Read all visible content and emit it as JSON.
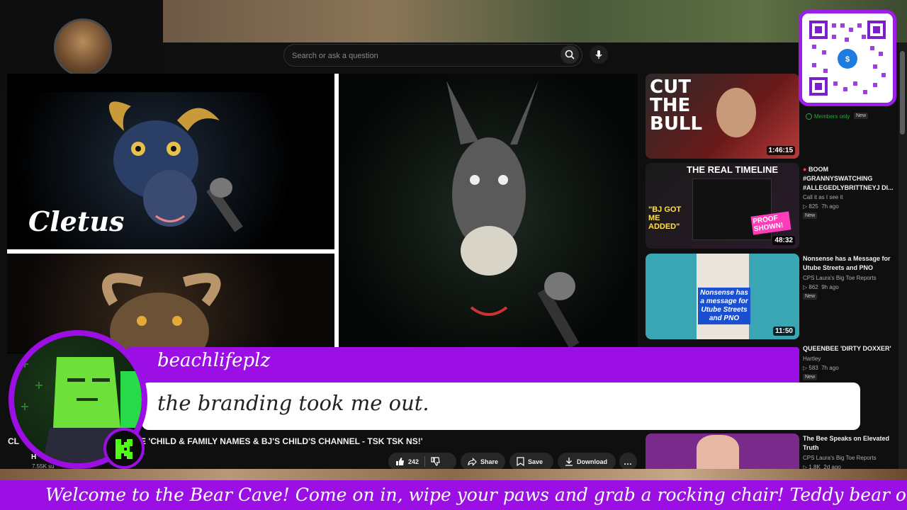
{
  "search": {
    "placeholder": "Search or ask a question"
  },
  "video": {
    "tile_label": "Cletus",
    "title_start": "CL",
    "title_rest": "E 'CHILD & FAMILY NAMES & BJ'S CHILD'S CHANNEL - TSK TSK NS!'",
    "channel_initial": "H",
    "subscriber_count": "7.55K su",
    "likes": "242",
    "share_label": "Share",
    "save_label": "Save",
    "download_label": "Download"
  },
  "chat": {
    "username": "beachlifeplz",
    "message": "the branding took me out."
  },
  "sidebar": [
    {
      "thumb_text": "CUT THE BULL",
      "duration": "1:46:15",
      "badge_members": "Members only",
      "badge_new": "New"
    },
    {
      "thumb_text": "THE REAL TIMELINE",
      "thumb_sub": "\"BJ GOT ME ADDED\"",
      "thumb_stamp": "PROOF SHOWN!",
      "duration": "48:32",
      "title": "BOOM #GRANNYSWATCHING #ALLEGEDLYBRITTNEYJ DI...",
      "channel": "Call it as I see it",
      "views": "825",
      "age": "7h ago",
      "badge_new": "New"
    },
    {
      "thumb_text": "Nonsense has a message for Utube Streets and PNO",
      "duration": "11:50",
      "title": "Nonsense has a Message for Utube Streets and PNO",
      "channel": "CPS Laura's Big Toe Reports",
      "views": "862",
      "age": "9h ago",
      "badge_new": "New"
    },
    {
      "title": "QUEENBEE 'DIRTY DOXXER'",
      "channel": "Hartley",
      "views": "583",
      "age": "7h ago",
      "badge_new": "New"
    },
    {
      "title": "The Bee Speaks on Elevated Truth",
      "channel": "CPS Laura's Big Toe Reports",
      "views": "1.8K",
      "age": "2d ago"
    }
  ],
  "ticker": {
    "text": "Welcome to the Bear Cave! Come on in, wipe your paws and grab a rocking chair! Teddy bear or grizzly bear, it al"
  },
  "colors": {
    "accent_purple": "#9b0fe4",
    "yt_dark": "#0f0f0f",
    "members_green": "#2ba640"
  },
  "icons": [
    "search-icon",
    "mic-icon",
    "like-icon",
    "dislike-icon",
    "share-icon",
    "save-icon",
    "download-icon",
    "more-icon",
    "kick-logo-icon",
    "qr-code"
  ]
}
